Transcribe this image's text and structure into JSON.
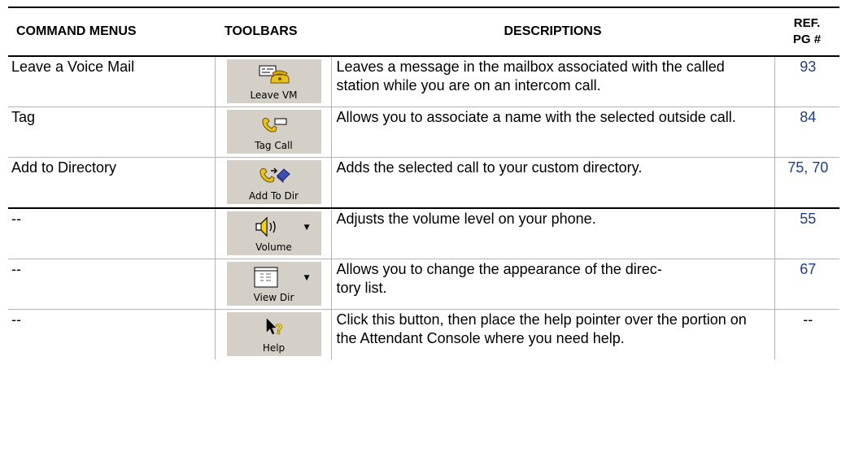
{
  "headers": {
    "command_menus": "COMMAND MENUS",
    "toolbars": "TOOLBARS",
    "descriptions": "DESCRIPTIONS",
    "ref_line1": "REF.",
    "ref_line2": "PG #"
  },
  "rows": [
    {
      "command": "Leave a Voice Mail",
      "toolbar_label": "Leave VM",
      "toolbar_icon": "voicemail-phone-icon",
      "description": "Leaves a message in the mailbox associated with the called station while you are on an intercom call.",
      "ref": "93"
    },
    {
      "command": "Tag",
      "toolbar_label": "Tag Call",
      "toolbar_icon": "tag-call-icon",
      "description": "Allows you to associate a name with the selected outside call.",
      "ref": "84"
    },
    {
      "command": "Add to Directory",
      "toolbar_label": "Add To Dir",
      "toolbar_icon": "add-to-directory-icon",
      "description": "Adds the selected call to your custom directory.",
      "ref": "75, 70"
    },
    {
      "command": "--",
      "toolbar_label": "Volume",
      "toolbar_icon": "speaker-volume-icon",
      "description": "Adjusts the volume level on your phone.",
      "ref": "55"
    },
    {
      "command": "--",
      "toolbar_label": "View Dir",
      "toolbar_icon": "list-view-icon",
      "description": "Allows you to change the appearance of the directory list.",
      "description_display": "Allows you to change the appearance of the direc-\ntory list.",
      "ref": "67"
    },
    {
      "command": "--",
      "toolbar_label": "Help",
      "toolbar_icon": "help-pointer-icon",
      "description": "Click this button, then place the help pointer over the portion on the Attendant Console where you need help.",
      "ref": "--"
    }
  ],
  "colors": {
    "link_ref": "#1f3d8a",
    "button_face": "#d4d0c8",
    "rule": "#000000",
    "grid": "#b4b4b4"
  }
}
